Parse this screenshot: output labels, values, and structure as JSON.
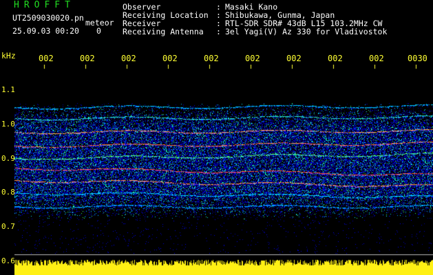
{
  "colors": {
    "background": "#000000",
    "green": "#22dd22",
    "white": "#ffffff",
    "yellow": "#ffff33",
    "axis_line": "#ffffff"
  },
  "header": {
    "app_title": "HROFFT",
    "file_name": "UT2509030020.pn",
    "meteor_label": "meteor",
    "date_time": "25.09.03 00:20",
    "counter": "0",
    "info": [
      {
        "label": "Observer",
        "value": "Masaki Kano"
      },
      {
        "label": "Receiving Location",
        "value": "Shibukawa, Gunma, Japan"
      },
      {
        "label": "Receiver",
        "value": "RTL-SDR SDR# 43dB L15 103.2MHz CW"
      },
      {
        "label": "Receiving Antenna",
        "value": "3el Yagi(V) Az 330 for Vladivostok"
      }
    ]
  },
  "axes": {
    "y_unit": "kHz",
    "y_ticks": [
      "1.1",
      "1.0",
      "0.9",
      "0.8",
      "0.7",
      "0.6"
    ],
    "x_ticks": [
      "002",
      "002",
      "002",
      "002",
      "002",
      "002",
      "002",
      "002",
      "002",
      "0030"
    ]
  }
}
